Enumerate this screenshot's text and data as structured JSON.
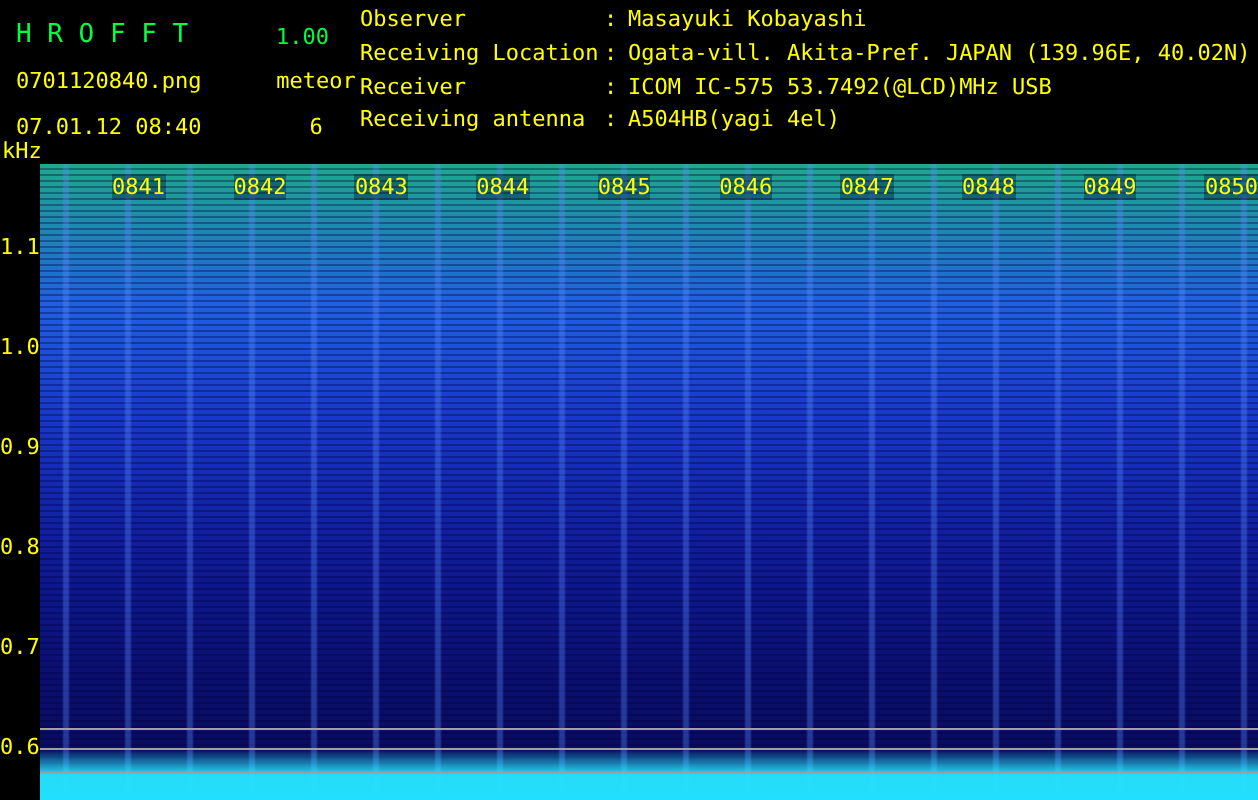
{
  "app": {
    "name": "H R O F F T",
    "version": "1.00"
  },
  "file": "0701120840.png",
  "datetime": "07.01.12 08:40",
  "meteor": {
    "label": "meteor",
    "count": "6"
  },
  "info": [
    {
      "label": "Observer",
      "separator": ":",
      "value": "Masayuki Kobayashi"
    },
    {
      "label": "Receiving Location",
      "separator": ":",
      "value": "Ogata-vill. Akita-Pref. JAPAN (139.96E, 40.02N)"
    },
    {
      "label": "Receiver",
      "separator": ":",
      "value": "ICOM IC-575 53.7492(@LCD)MHz USB"
    },
    {
      "label": "Receiving antenna",
      "separator": ":",
      "value": "A504HB(yagi 4el)"
    }
  ],
  "chart": {
    "unit": "kHz",
    "time_labels": [
      "0841",
      "0842",
      "0843",
      "0844",
      "0845",
      "0846",
      "0847",
      "0848",
      "0849",
      "0850"
    ],
    "freq_labels": [
      "1.1",
      "1.0",
      "0.9",
      "0.8",
      "0.7",
      "0.6"
    ]
  }
}
